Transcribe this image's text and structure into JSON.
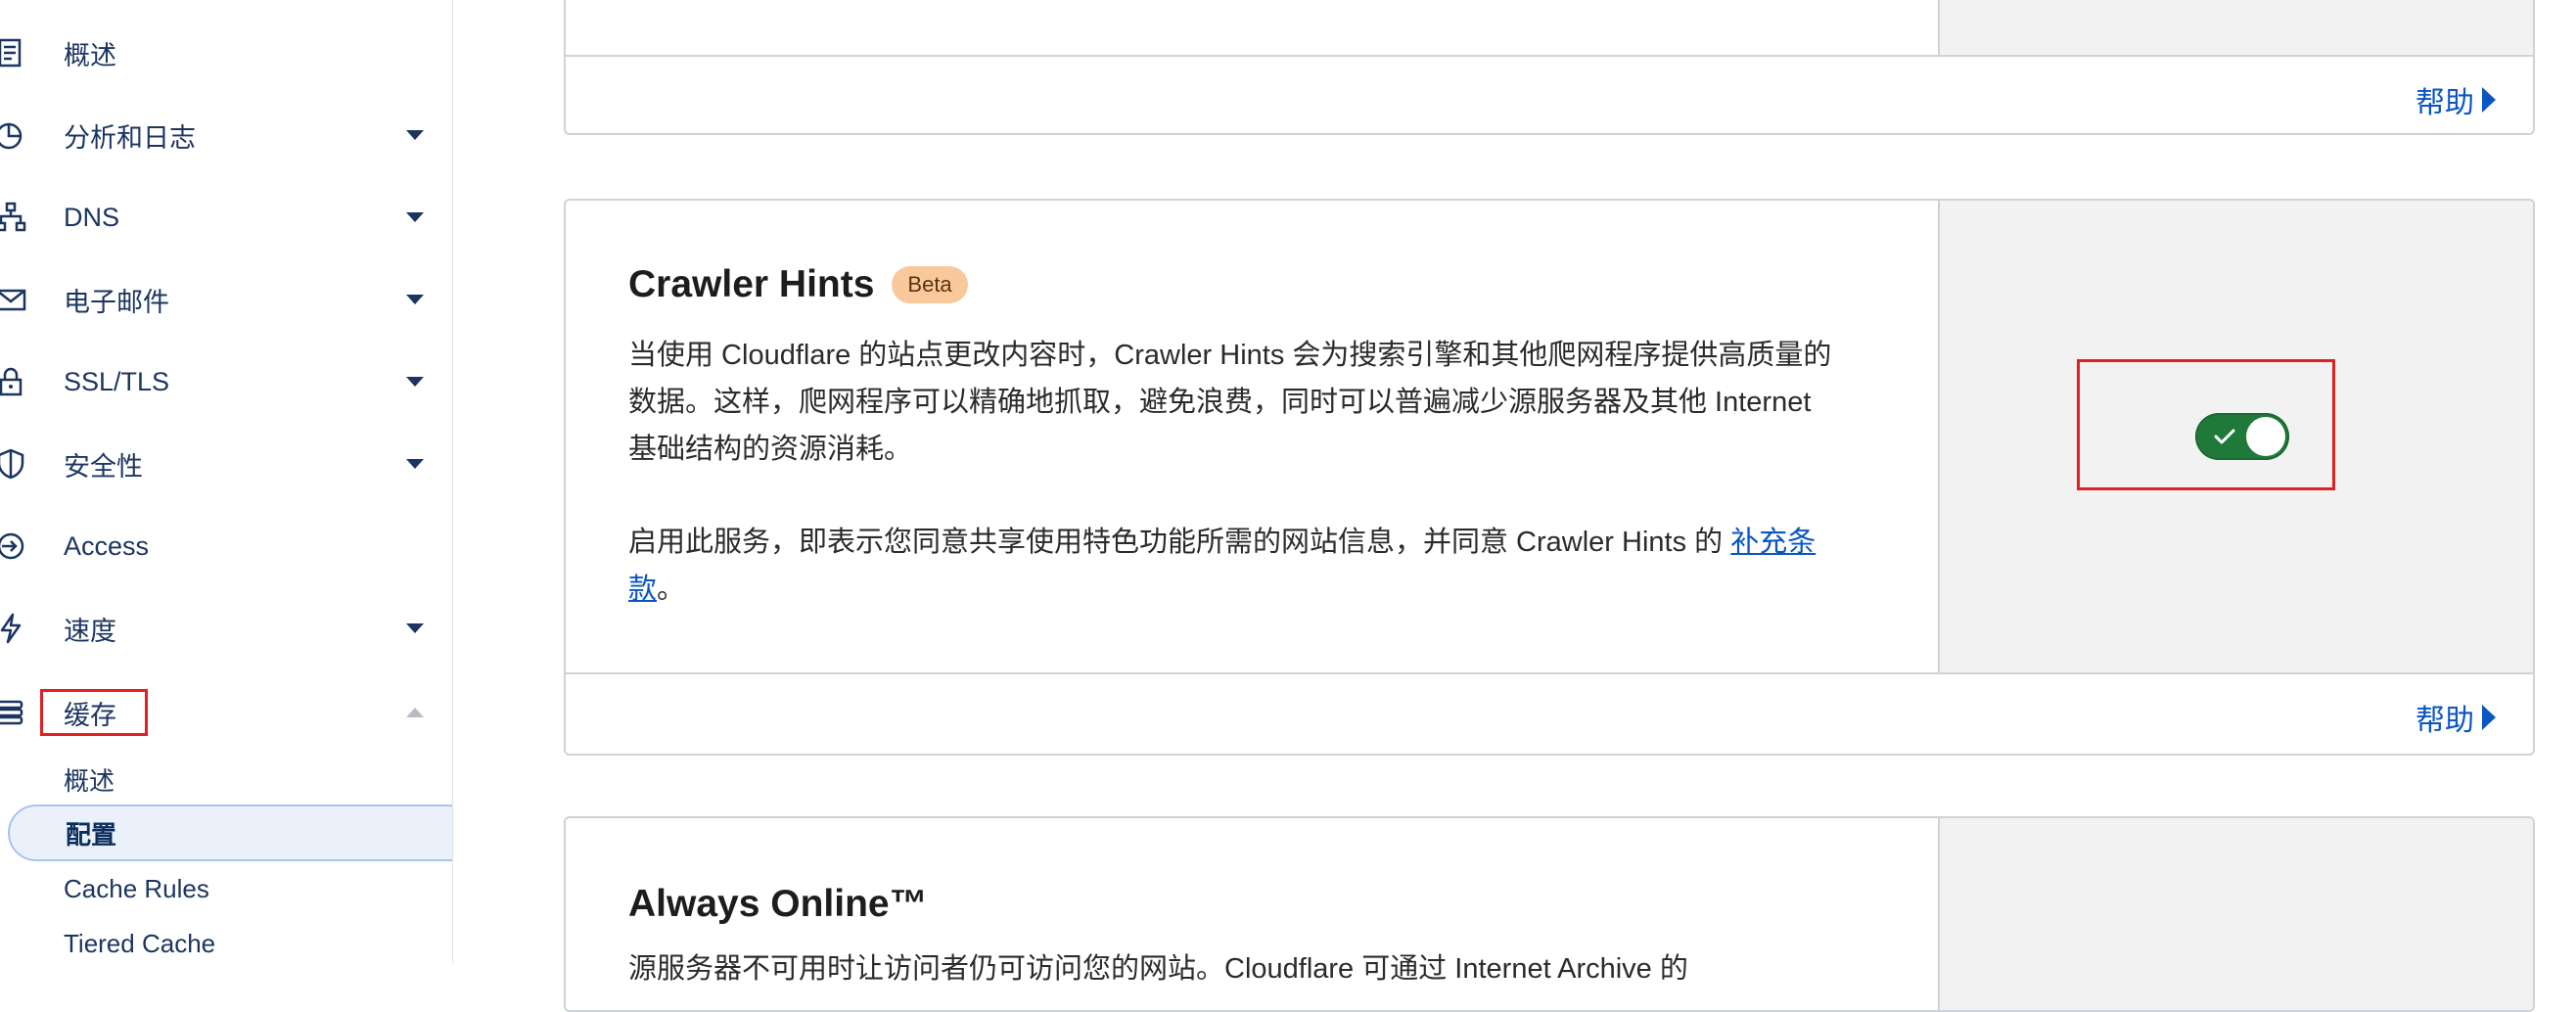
{
  "sidebar": {
    "items": [
      {
        "label": "概述",
        "icon": "document-icon",
        "has_caret": false
      },
      {
        "label": "分析和日志",
        "icon": "pie-chart-icon",
        "has_caret": true
      },
      {
        "label": "DNS",
        "icon": "network-icon",
        "has_caret": true
      },
      {
        "label": "电子邮件",
        "icon": "envelope-icon",
        "has_caret": true
      },
      {
        "label": "SSL/TLS",
        "icon": "lock-icon",
        "has_caret": true
      },
      {
        "label": "安全性",
        "icon": "shield-icon",
        "has_caret": true
      },
      {
        "label": "Access",
        "icon": "access-icon",
        "has_caret": false
      },
      {
        "label": "速度",
        "icon": "lightning-icon",
        "has_caret": true
      },
      {
        "label": "缓存",
        "icon": "cache-stack-icon",
        "has_caret": true,
        "expanded": true
      }
    ],
    "cache_subitems": [
      {
        "label": "概述",
        "active": false
      },
      {
        "label": "配置",
        "active": true
      },
      {
        "label": "Cache Rules",
        "active": false
      },
      {
        "label": "Tiered Cache",
        "active": false
      }
    ]
  },
  "cards": {
    "top": {
      "help_label": "帮助"
    },
    "crawler_hints": {
      "title": "Crawler Hints",
      "badge": "Beta",
      "description_1": "当使用 Cloudflare 的站点更改内容时，Crawler Hints 会为搜索引擎和其他爬网程序提供高质量的数据。这样，爬网程序可以精确地抓取，避免浪费，同时可以普遍减少源服务器及其他 Internet 基础结构的资源消耗。",
      "description_2_prefix": "启用此服务，即表示您同意共享使用特色功能所需的网站信息，并同意 Crawler Hints 的 ",
      "description_2_link": "补充条款",
      "description_2_suffix": "。",
      "toggle_on": true,
      "help_label": "帮助"
    },
    "always_online": {
      "title": "Always Online™",
      "description_partial": "源服务器不可用时让访问者仍可访问您的网站。Cloudflare 可通过 Internet Archive 的"
    }
  },
  "colors": {
    "accent_link": "#0a55c4",
    "toggle_on": "#1f7a3a",
    "highlight_box": "#e1201f",
    "nav_text": "#1c3560"
  }
}
